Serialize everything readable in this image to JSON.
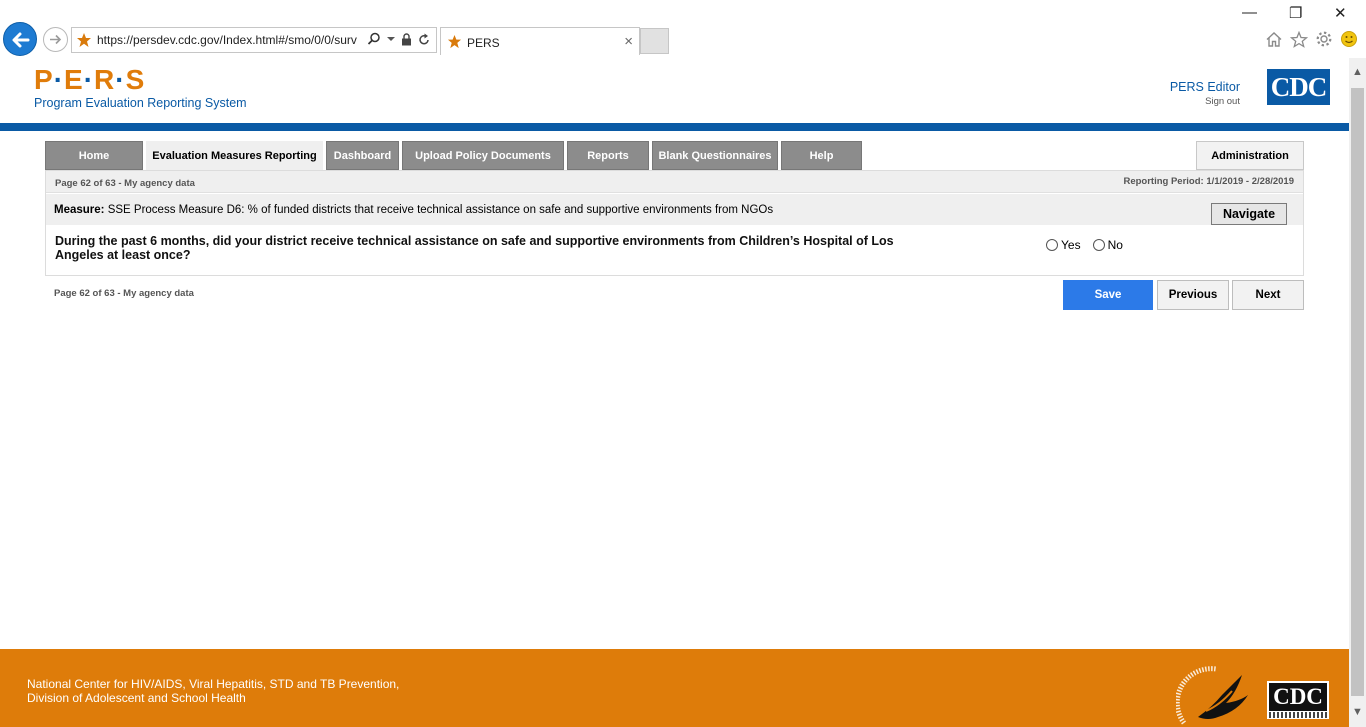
{
  "browser": {
    "url": "https://persdev.cdc.gov/Index.html#/smo/0/0/surv",
    "tab_title": "PERS",
    "tab_close": "×",
    "win_minimize": "—",
    "win_restore": "❐",
    "win_close": "✕"
  },
  "header": {
    "logo_letters": [
      "P",
      "E",
      "R",
      "S"
    ],
    "logo_subtitle": "Program Evaluation Reporting System",
    "user_name": "PERS Editor",
    "sign_out": "Sign out",
    "cdc_logo_text": "CDC"
  },
  "nav": {
    "tabs": [
      {
        "label": "Home"
      },
      {
        "label": "Evaluation Measures Reporting"
      },
      {
        "label": "Dashboard"
      },
      {
        "label": "Upload Policy Documents"
      },
      {
        "label": "Reports"
      },
      {
        "label": "Blank Questionnaires"
      },
      {
        "label": "Help"
      }
    ],
    "admin_label": "Administration"
  },
  "survey": {
    "page_info": "Page 62 of 63 - My agency data",
    "reporting_period": "Reporting Period: 1/1/2019 - 2/28/2019",
    "measure_prefix": "Measure:",
    "measure_text": "SSE Process Measure D6: % of funded districts that receive technical assistance on safe and supportive environments from NGOs",
    "navigate_label": "Navigate",
    "question_text": "During the past 6 months, did your district receive technical assistance on safe and supportive environments from Children’s Hospital of Los Angeles at least once?",
    "options": [
      {
        "label": "Yes"
      },
      {
        "label": "No"
      }
    ],
    "page_info_bottom": "Page 62 of 63 - My agency data"
  },
  "actions": {
    "save_label": "Save",
    "previous_label": "Previous",
    "next_label": "Next"
  },
  "footer": {
    "line1": "National Center for HIV/AIDS, Viral Hepatitis, STD and TB Prevention,",
    "line2": "Division of Adolescent and School Health",
    "cdc_logo_text": "CDC"
  },
  "colors": {
    "brand_orange": "#de7c0a",
    "brand_blue": "#0a5aa5",
    "save_blue": "#2c7ae8",
    "tab_gray": "#8c8c8c"
  }
}
